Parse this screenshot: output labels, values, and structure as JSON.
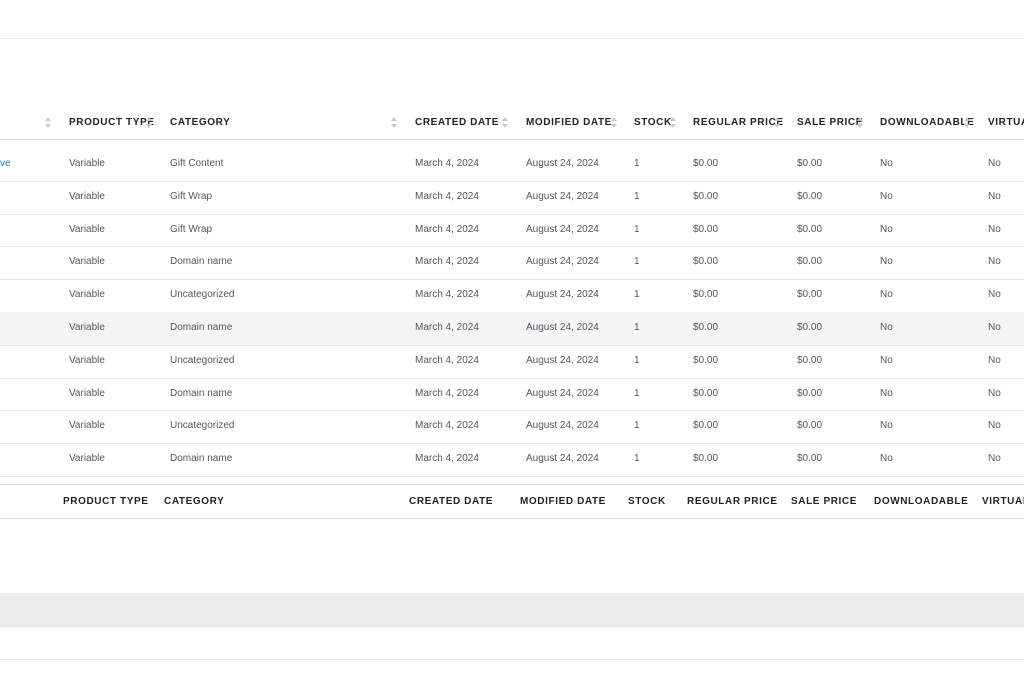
{
  "table": {
    "header": {
      "product_type": "PRODUCT TYPE",
      "category": "CATEGORY",
      "created_date": "CREATED DATE",
      "modified_date": "MODIFIED DATE",
      "stock": "STOCK",
      "regular_price": "REGULAR PRICE",
      "sale_price": "SALE PRICE",
      "downloadable": "DOWNLOADABLE",
      "virtual": "VIRTUA"
    },
    "footer": {
      "product_type": "PRODUCT TYPE",
      "category": "CATEGORY",
      "created_date": "CREATED DATE",
      "modified_date": "MODIFIED DATE",
      "stock": "STOCK",
      "regular_price": "REGULAR PRICE",
      "sale_price": "SALE PRICE",
      "downloadable": "DOWNLOADABLE",
      "virtual": "VIRTUAL"
    },
    "rows": [
      {
        "prefix": "ve",
        "type": "Variable",
        "category": "Gift Content",
        "created": "March 4, 2024",
        "modified": "August 24, 2024",
        "stock": "1",
        "regular": "$0.00",
        "sale": "$0.00",
        "downloadable": "No",
        "virtual": "No"
      },
      {
        "prefix": "",
        "type": "Variable",
        "category": "Gift Wrap",
        "created": "March 4, 2024",
        "modified": "August 24, 2024",
        "stock": "1",
        "regular": "$0.00",
        "sale": "$0.00",
        "downloadable": "No",
        "virtual": "No"
      },
      {
        "prefix": "",
        "type": "Variable",
        "category": "Gift Wrap",
        "created": "March 4, 2024",
        "modified": "August 24, 2024",
        "stock": "1",
        "regular": "$0.00",
        "sale": "$0.00",
        "downloadable": "No",
        "virtual": "No"
      },
      {
        "prefix": "",
        "type": "Variable",
        "category": "Domain name",
        "created": "March 4, 2024",
        "modified": "August 24, 2024",
        "stock": "1",
        "regular": "$0.00",
        "sale": "$0.00",
        "downloadable": "No",
        "virtual": "No"
      },
      {
        "prefix": "",
        "type": "Variable",
        "category": "Uncategorized",
        "created": "March 4, 2024",
        "modified": "August 24, 2024",
        "stock": "1",
        "regular": "$0.00",
        "sale": "$0.00",
        "downloadable": "No",
        "virtual": "No"
      },
      {
        "prefix": "",
        "type": "Variable",
        "category": "Domain name",
        "created": "March 4, 2024",
        "modified": "August 24, 2024",
        "stock": "1",
        "regular": "$0.00",
        "sale": "$0.00",
        "downloadable": "No",
        "virtual": "No"
      },
      {
        "prefix": "",
        "type": "Variable",
        "category": "Uncategorized",
        "created": "March 4, 2024",
        "modified": "August 24, 2024",
        "stock": "1",
        "regular": "$0.00",
        "sale": "$0.00",
        "downloadable": "No",
        "virtual": "No"
      },
      {
        "prefix": "",
        "type": "Variable",
        "category": "Domain name",
        "created": "March 4, 2024",
        "modified": "August 24, 2024",
        "stock": "1",
        "regular": "$0.00",
        "sale": "$0.00",
        "downloadable": "No",
        "virtual": "No"
      },
      {
        "prefix": "",
        "type": "Variable",
        "category": "Uncategorized",
        "created": "March 4, 2024",
        "modified": "August 24, 2024",
        "stock": "1",
        "regular": "$0.00",
        "sale": "$0.00",
        "downloadable": "No",
        "virtual": "No"
      },
      {
        "prefix": "",
        "type": "Variable",
        "category": "Domain name",
        "created": "March 4, 2024",
        "modified": "August 24, 2024",
        "stock": "1",
        "regular": "$0.00",
        "sale": "$0.00",
        "downloadable": "No",
        "virtual": "No"
      }
    ]
  },
  "colors": {
    "link": "#2271b1",
    "header_text": "#1d2327",
    "cell_text": "#50575e",
    "hover_row": "#f5f5f5",
    "band": "#ececec"
  }
}
